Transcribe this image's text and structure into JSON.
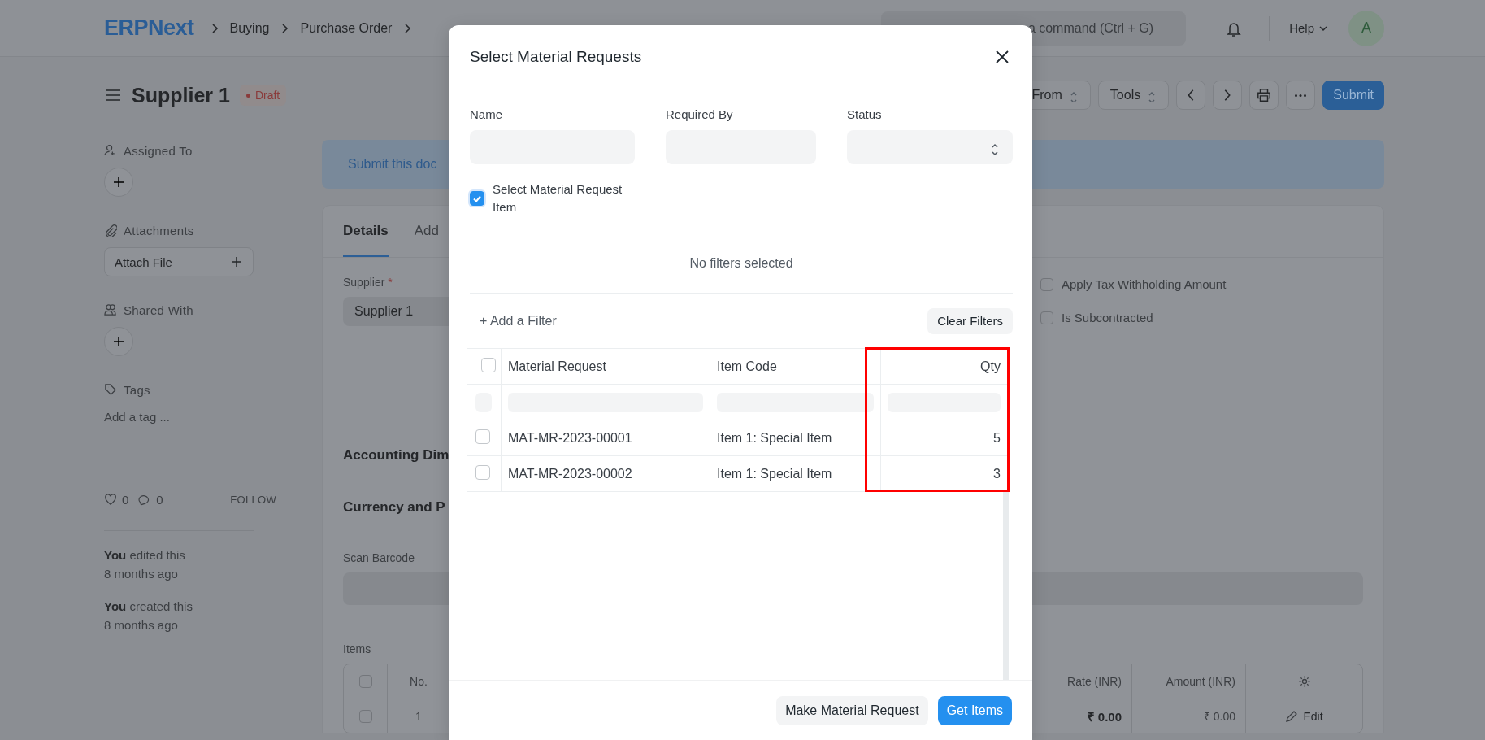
{
  "navbar": {
    "logo": "ERPNext",
    "breadcrumbs": [
      "Buying",
      "Purchase Order"
    ],
    "search": {
      "placeholder": "a command (Ctrl + G)"
    },
    "help": "Help",
    "avatar": "A"
  },
  "page_head": {
    "title": "Supplier 1",
    "status": "Draft",
    "actions": [
      {
        "label": "From"
      },
      {
        "label": "Tools"
      }
    ],
    "primary_action": "Submit"
  },
  "sidebar": {
    "assigned_to": {
      "label": "Assigned To"
    },
    "attachments": {
      "label": "Attachments",
      "button": "Attach File"
    },
    "shared_with": {
      "label": "Shared With"
    },
    "tags": {
      "label": "Tags",
      "add_link": "Add a tag ..."
    },
    "likes": "0",
    "comments": "0",
    "follow": "FOLLOW",
    "activity": [
      {
        "text": "**You** edited this",
        "time": "8 months ago"
      },
      {
        "text": "**You** created this",
        "time": "8 months ago"
      }
    ]
  },
  "main": {
    "banner": "Submit this doc",
    "tabs": [
      {
        "label": "Details",
        "selected": true
      },
      {
        "label": "Add",
        "selected": false
      }
    ],
    "supplier": {
      "label": "Supplier",
      "required_mark": "*",
      "value": "Supplier 1"
    },
    "checks": [
      {
        "label": "Apply Tax Withholding Amount",
        "checked": false
      },
      {
        "label": "Is Subcontracted",
        "checked": false
      }
    ],
    "sections": [
      "Accounting Dim",
      "Currency and P"
    ],
    "scan_barcode": {
      "label": "Scan Barcode"
    },
    "items": {
      "label": "Items",
      "select_all": false,
      "columns": [
        "No.",
        "Rate (INR)",
        "Amount (INR)"
      ],
      "rows": [
        {
          "checked": false,
          "no": "1",
          "rate": "₹ 0.00",
          "amount": "₹ 0.00",
          "action": "Edit"
        }
      ]
    }
  },
  "dialog": {
    "title": "Select Material Requests",
    "fields": [
      {
        "label": "Name",
        "kind": "text"
      },
      {
        "label": "Required By",
        "kind": "text"
      },
      {
        "label": "Status",
        "kind": "select"
      }
    ],
    "check": {
      "label": "Select Material Request Item",
      "checked": true
    },
    "filter_note": "No filters selected",
    "add_filter": "+ Add a Filter",
    "clear_filters": "Clear Filters",
    "table": {
      "select_all": false,
      "columns": [
        {
          "label": "Material Request",
          "kind": "text",
          "highlighted": false
        },
        {
          "label": "Item Code",
          "kind": "text",
          "highlighted": false
        },
        {
          "label": "Qty",
          "kind": "number",
          "highlighted": true
        }
      ],
      "rows": [
        {
          "selected": false,
          "cells": [
            "MAT-MR-2023-00001",
            "Item 1: Special Item",
            "5"
          ]
        },
        {
          "selected": false,
          "cells": [
            "MAT-MR-2023-00002",
            "Item 1: Special Item",
            "3"
          ]
        }
      ]
    },
    "buttons": [
      {
        "label": "Make Material Request",
        "kind": "secondary"
      },
      {
        "label": "Get Items",
        "kind": "primary"
      }
    ]
  }
}
